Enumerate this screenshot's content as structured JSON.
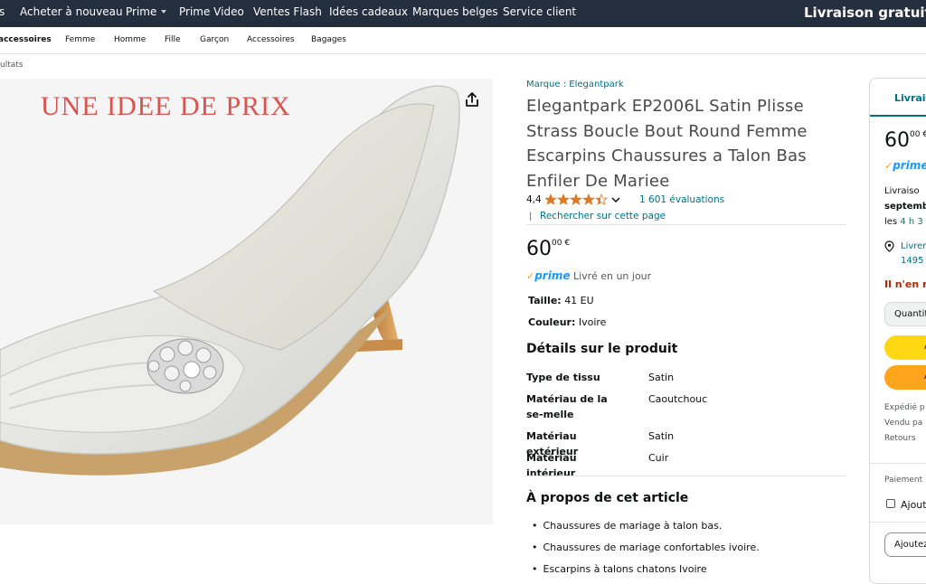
{
  "topnav": {
    "partial_left": "s",
    "items": [
      "Acheter à nouveau",
      "Prime",
      "Prime Video",
      "Ventes Flash",
      "Idées cadeaux",
      "Marques belges",
      "Service client"
    ],
    "promo": "Livraison gratuit"
  },
  "subnav": {
    "items": [
      "accessoires",
      "Femme",
      "Homme",
      "Fille",
      "Garçon",
      "Accessoires",
      "Bagages"
    ]
  },
  "breadcrumb": "ultats",
  "image": {
    "watermark": "UNE IDEE DE PRIX"
  },
  "product": {
    "brand": "Marque : Elegantpark",
    "title": "Elegantpark EP2006L Satin Plisse Strass Boucle Bout Round Femme Escarpins Chaussures a Talon Bas Enfiler De Mariee",
    "rating": "4,4",
    "stars": 4.4,
    "ratings_count": "1 601 évaluations",
    "search_link": "Rechercher sur cette page",
    "separator": "|",
    "price_main": "60",
    "price_cents": "00 €",
    "prime": "prime",
    "delivery": "Livré en un jour",
    "size_label": "Taille:",
    "size_value": "41 EU",
    "color_label": "Couleur:",
    "color_value": "Ivoire"
  },
  "details": {
    "title": "Détails sur le produit",
    "rows": [
      {
        "label": "Type de tissu",
        "value": "Satin"
      },
      {
        "label": "Matériau de la se-melle",
        "value": "Caoutchouc"
      },
      {
        "label": "Matériau extérieur",
        "value": "Satin"
      },
      {
        "label": "Matériau intérieur",
        "value": "Cuir"
      }
    ]
  },
  "about": {
    "title": "À propos de cet article",
    "bullets": [
      "Chaussures de mariage à talon bas.",
      "Chaussures de mariage confortables ivoire.",
      "Escarpins à talons chatons Ivoire"
    ]
  },
  "buybox": {
    "tab": "Livrais",
    "price_main": "60",
    "price_cents": "00 €",
    "prime": "prime",
    "delivery_1": "Livraiso",
    "delivery_2": "septemb",
    "delivery_3a": "les ",
    "delivery_3b": "4 h 3",
    "location_1": "Livrer",
    "location_2": "1495",
    "stock": "Il n'en re",
    "quantity": "Quantit",
    "btn1": "A",
    "btn2": "A",
    "shipped": "Expédié p",
    "sold": "Vendu pa",
    "returns": "Retours",
    "payment": "Paiement",
    "add_check": "Ajout",
    "add_list": "Ajoutez"
  },
  "colors": {
    "nav": "#232f3e",
    "link": "#007185",
    "star": "#de7921",
    "prime": "#1a98ff",
    "buy_yellow": "#ffd814",
    "buy_orange": "#ffa41c",
    "stock_red": "#b12704",
    "delivery_green": "#067d62"
  }
}
